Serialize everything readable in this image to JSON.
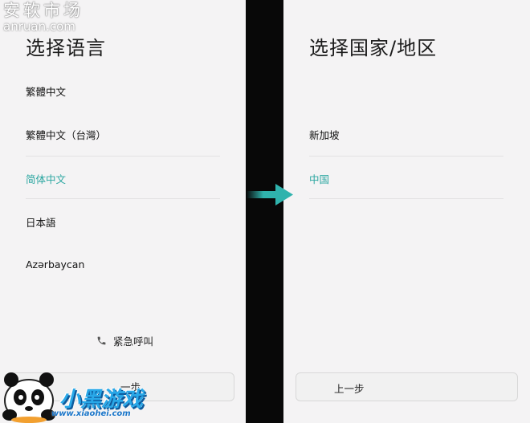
{
  "watermark_top": {
    "name": "安软市场",
    "domain": "anruan.com"
  },
  "left_screen": {
    "title": "选择语言",
    "languages": [
      {
        "label": "繁體中文",
        "selected": false
      },
      {
        "label": "繁體中文（台灣）",
        "selected": false
      },
      {
        "label": "简体中文",
        "selected": true
      },
      {
        "label": "日本語",
        "selected": false
      },
      {
        "label": "Azərbaycan",
        "selected": false
      }
    ],
    "emergency_icon": "phone-icon",
    "emergency_label": "紧急呼叫",
    "prev_button_label": "一步"
  },
  "right_screen": {
    "title": "选择国家/地区",
    "regions": [
      {
        "label": "新加坡",
        "selected": false
      },
      {
        "label": "中国",
        "selected": true
      }
    ],
    "prev_button_label": "上一步"
  },
  "watermark_bottom": {
    "brand": "小黑游戏",
    "url": "www.xiaohei.com"
  },
  "colors": {
    "accent": "#2aa6a0",
    "arrow": "#2fb3ad",
    "divider": "#080808",
    "background": "#f4f3f4"
  }
}
